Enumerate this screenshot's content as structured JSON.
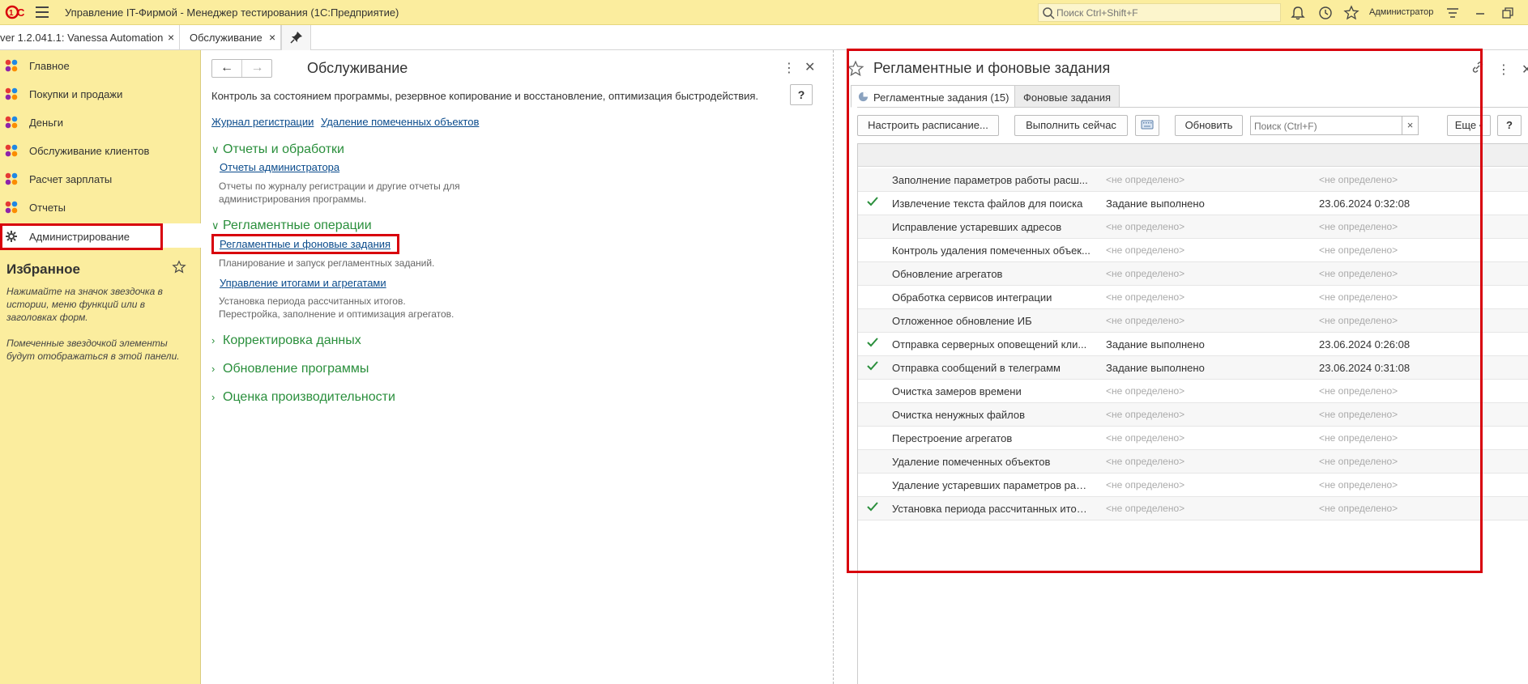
{
  "app": {
    "title": "Управление IT-Фирмой  - Менеджер тестирования (1С:Предприятие)",
    "search_placeholder": "Поиск Ctrl+Shift+F",
    "user": "Администратор"
  },
  "tabs": [
    {
      "label": "ver 1.2.041.1: Vanessa Automation",
      "close": "×"
    },
    {
      "label": "Обслуживание",
      "close": "×"
    }
  ],
  "sidebar": {
    "items": [
      {
        "label": "Главное"
      },
      {
        "label": "Покупки и продажи"
      },
      {
        "label": "Деньги"
      },
      {
        "label": "Обслуживание клиентов"
      },
      {
        "label": "Расчет зарплаты"
      },
      {
        "label": "Отчеты"
      },
      {
        "label": "Администрирование"
      }
    ],
    "favorites_title": "Избранное",
    "favorites_hint1": "Нажимайте на значок звездочка в истории, меню функций или в заголовках форм.",
    "favorites_hint2": "Помеченные звездочкой элементы будут отображаться в этой панели."
  },
  "middle": {
    "title": "Обслуживание",
    "description": "Контроль за состоянием программы, резервное копирование и восстановление, оптимизация быстродействия.",
    "help": "?",
    "top_links": [
      "Журнал регистрации",
      "Удаление помеченных объектов"
    ],
    "groups": {
      "reports": {
        "title": "Отчеты и обработки",
        "link": "Отчеты администратора",
        "desc": [
          "Отчеты по журналу регистрации и другие отчеты для",
          "администрирования программы."
        ]
      },
      "routine": {
        "title": "Регламентные операции",
        "link1": "Регламентные и фоновые задания",
        "desc1": "Планирование и запуск регламентных заданий.",
        "link2": "Управление итогами и агрегатами",
        "desc2": [
          "Установка периода рассчитанных итогов.",
          "Перестройка, заполнение и оптимизация агрегатов."
        ]
      },
      "collapsed": [
        "Корректировка данных",
        "Обновление программы",
        "Оценка производительности"
      ]
    }
  },
  "right": {
    "title": "Регламентные и фоновые задания",
    "subtabs": [
      "Регламентные задания (15)",
      "Фоновые задания"
    ],
    "buttons": {
      "schedule": "Настроить расписание...",
      "run_now": "Выполнить сейчас",
      "refresh": "Обновить",
      "more": "Еще",
      "help": "?"
    },
    "search_placeholder": "Поиск (Ctrl+F)",
    "search_clear": "×",
    "rows": [
      {
        "name": "Заполнение параметров работы расш...",
        "status": "<не определено>",
        "date": "<не определено>",
        "checked": false
      },
      {
        "name": "Извлечение текста файлов для поиска",
        "status": "Задание выполнено",
        "date": "23.06.2024 0:32:08",
        "checked": true
      },
      {
        "name": "Исправление устаревших адресов",
        "status": "<не определено>",
        "date": "<не определено>",
        "checked": false
      },
      {
        "name": "Контроль удаления помеченных объек...",
        "status": "<не определено>",
        "date": "<не определено>",
        "checked": false
      },
      {
        "name": "Обновление агрегатов",
        "status": "<не определено>",
        "date": "<не определено>",
        "checked": false
      },
      {
        "name": "Обработка сервисов интеграции",
        "status": "<не определено>",
        "date": "<не определено>",
        "checked": false
      },
      {
        "name": "Отложенное обновление ИБ",
        "status": "<не определено>",
        "date": "<не определено>",
        "checked": false
      },
      {
        "name": "Отправка серверных оповещений кли...",
        "status": "Задание выполнено",
        "date": "23.06.2024 0:26:08",
        "checked": true
      },
      {
        "name": "Отправка сообщений в телеграмм",
        "status": "Задание выполнено",
        "date": "23.06.2024 0:31:08",
        "checked": true
      },
      {
        "name": "Очистка замеров времени",
        "status": "<не определено>",
        "date": "<не определено>",
        "checked": false
      },
      {
        "name": "Очистка ненужных файлов",
        "status": "<не определено>",
        "date": "<не определено>",
        "checked": false
      },
      {
        "name": "Перестроение агрегатов",
        "status": "<не определено>",
        "date": "<не определено>",
        "checked": false
      },
      {
        "name": "Удаление помеченных объектов",
        "status": "<не определено>",
        "date": "<не определено>",
        "checked": false
      },
      {
        "name": "Удаление устаревших параметров раб...",
        "status": "<не определено>",
        "date": "<не определено>",
        "checked": false
      },
      {
        "name": "Установка периода рассчитанных итогов",
        "status": "<не определено>",
        "date": "<не определено>",
        "checked": true
      }
    ]
  },
  "colors": {
    "sidebar_bg": "#fbed9e",
    "accent_green": "#2a8f3c",
    "link_blue": "#0a4b8c",
    "highlight_red": "#d8000c"
  }
}
